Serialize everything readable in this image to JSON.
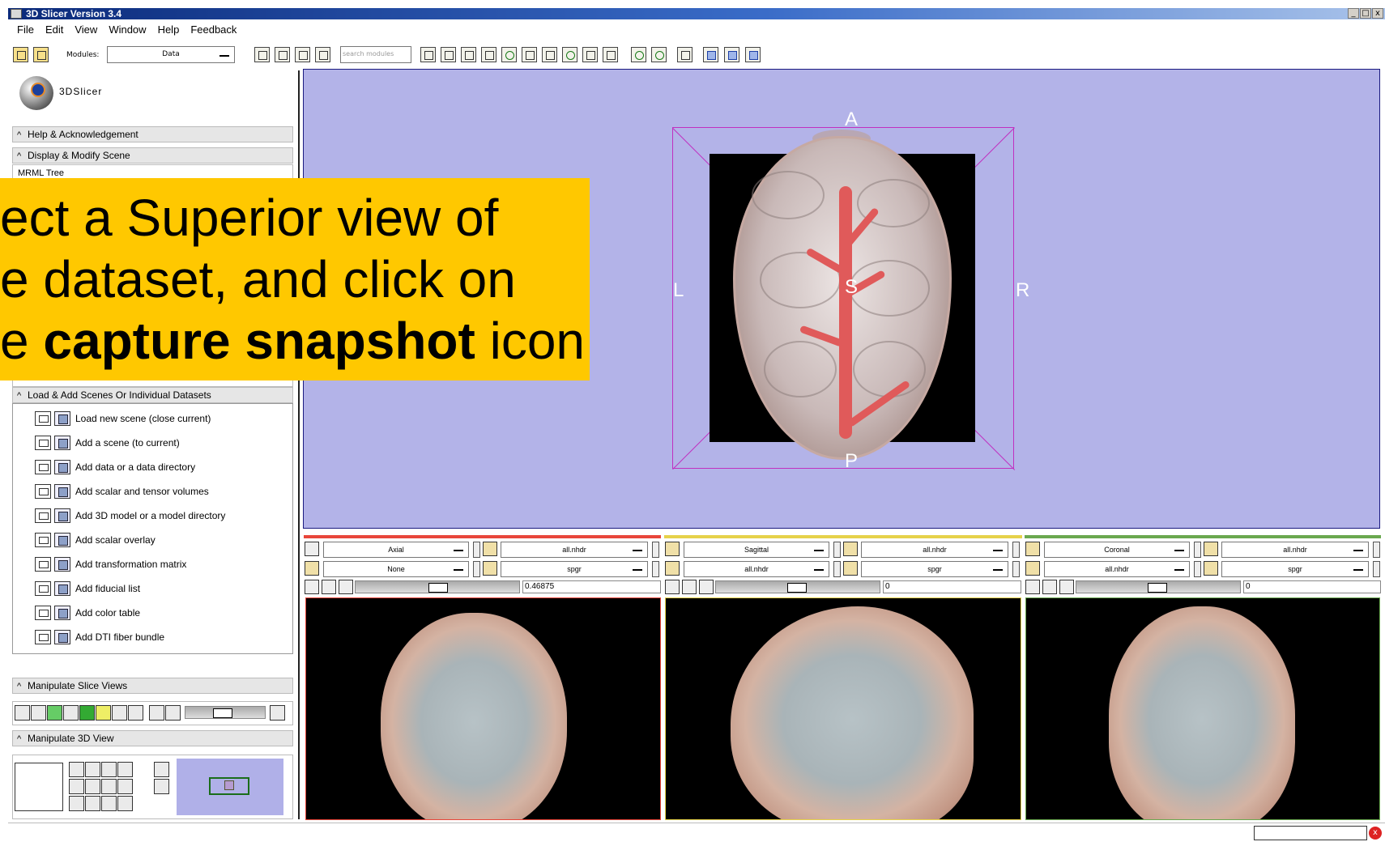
{
  "window": {
    "title": "3D Slicer Version 3.4",
    "controls": [
      "_",
      "□",
      "x"
    ]
  },
  "menu": [
    "File",
    "Edit",
    "View",
    "Window",
    "Help",
    "Feedback"
  ],
  "toolbar": {
    "modules_label": "Modules:",
    "module_value": "Data",
    "search_placeholder": "search modules"
  },
  "logo": {
    "text": "3DSlicer"
  },
  "left": {
    "help_section": "Help & Acknowledgement",
    "display_section": "Display & Modify Scene",
    "mrml_tree_label": "MRML Tree",
    "load_section": "Load & Add Scenes Or Individual Datasets",
    "load_items": [
      "Load new scene (close current)",
      "Add a scene (to current)",
      "Add data or a data directory",
      "Add scalar and tensor volumes",
      "Add 3D model or a model directory",
      "Add scalar overlay",
      "Add transformation matrix",
      "Add fiducial list",
      "Add color table",
      "Add DTI fiber bundle"
    ],
    "slice_section": "Manipulate Slice Views",
    "view3d_section": "Manipulate 3D View"
  },
  "view3d": {
    "labels": {
      "a": "A",
      "l": "L",
      "r": "R",
      "s": "S",
      "p": "P"
    },
    "background": "#b3b3e8"
  },
  "callout": {
    "line1": "ect a Superior view of",
    "line2": "e dataset, and click on",
    "line3_prefix": "e ",
    "line3_bold": "capture snapshot",
    "line3_suffix": " icon",
    "color": "#ffc800"
  },
  "slices": [
    {
      "orientation": "Axial",
      "foreground": "all.nhdr",
      "label": "None",
      "background_volume": "spgr",
      "offset": "0.46875",
      "color": "#e8463a"
    },
    {
      "orientation": "Sagittal",
      "foreground": "all.nhdr",
      "label": "all.nhdr",
      "background_volume": "spgr",
      "offset": "0",
      "color": "#e6d24a"
    },
    {
      "orientation": "Coronal",
      "foreground": "all.nhdr",
      "label": "all.nhdr",
      "background_volume": "spgr",
      "offset": "0",
      "color": "#6aa84f"
    }
  ]
}
